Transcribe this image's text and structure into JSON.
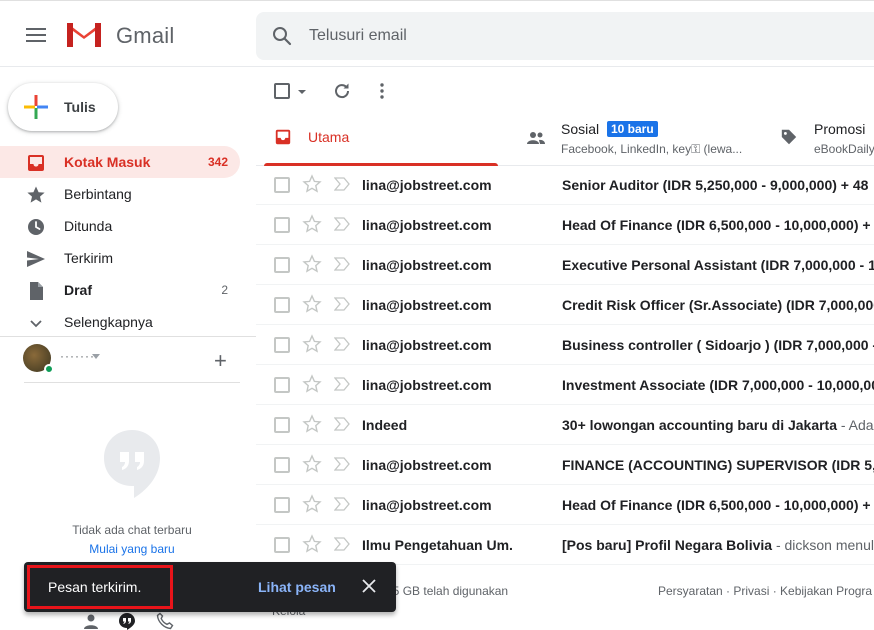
{
  "app": {
    "name": "Gmail"
  },
  "search": {
    "placeholder": "Telusuri email"
  },
  "compose": {
    "label": "Tulis"
  },
  "sidebar": {
    "items": [
      {
        "label": "Kotak Masuk",
        "count": "342",
        "icon": "inbox-icon",
        "active": true
      },
      {
        "label": "Berbintang",
        "count": "",
        "icon": "star-icon"
      },
      {
        "label": "Ditunda",
        "count": "",
        "icon": "clock-icon"
      },
      {
        "label": "Terkirim",
        "count": "",
        "icon": "send-icon"
      },
      {
        "label": "Draf",
        "count": "2",
        "icon": "draft-icon"
      },
      {
        "label": "Selengkapnya",
        "count": "",
        "icon": "chevron-down-icon"
      }
    ]
  },
  "hangouts": {
    "user_name": "·······",
    "empty_text": "Tidak ada chat terbaru",
    "start_link": "Mulai yang baru"
  },
  "tabs": [
    {
      "label": "Utama"
    },
    {
      "label": "Sosial",
      "badge": "10 baru",
      "sub": "Facebook, LinkedIn, key⚿ (lewa..."
    },
    {
      "label": "Promosi",
      "sub": "eBookDaily"
    }
  ],
  "emails": [
    {
      "sender": "lina@jobstreet.com",
      "subject": "Senior Auditor (IDR 5,250,000 - 9,000,000) + 48",
      "snippet": ""
    },
    {
      "sender": "lina@jobstreet.com",
      "subject": "Head Of Finance (IDR 6,500,000 - 10,000,000) +",
      "snippet": ""
    },
    {
      "sender": "lina@jobstreet.com",
      "subject": "Executive Personal Assistant (IDR 7,000,000 - 14",
      "snippet": ""
    },
    {
      "sender": "lina@jobstreet.com",
      "subject": "Credit Risk Officer (Sr.Associate) (IDR 7,000,000",
      "snippet": ""
    },
    {
      "sender": "lina@jobstreet.com",
      "subject": "Business controller ( Sidoarjo ) (IDR 7,000,000 -",
      "snippet": ""
    },
    {
      "sender": "lina@jobstreet.com",
      "subject": "Investment Associate (IDR 7,000,000 - 10,000,00",
      "snippet": ""
    },
    {
      "sender": "Indeed",
      "subject": "30+ lowongan accounting baru di Jakarta",
      "snippet": " - Ada l"
    },
    {
      "sender": "lina@jobstreet.com",
      "subject": "FINANCE (ACCOUNTING) SUPERVISOR (IDR 5,00",
      "snippet": ""
    },
    {
      "sender": "lina@jobstreet.com",
      "subject": "Head Of Finance (IDR 6,500,000 - 10,000,000) +",
      "snippet": ""
    },
    {
      "sender": "Ilmu Pengetahuan Um.",
      "subject": "[Pos baru] Profil Negara Bolivia",
      "snippet": " - dickson menulis"
    }
  ],
  "footer": {
    "storage": "a 15 GB telah digunakan",
    "manage": "Kelola",
    "links": "Persyaratan · Privasi · Kebijakan Progra"
  },
  "toast": {
    "message": "Pesan terkirim.",
    "action": "Lihat pesan"
  },
  "colors": {
    "accent": "#d93025",
    "badge": "#1a73e8",
    "toast_bg": "#202124",
    "highlight": "#e8141a"
  }
}
